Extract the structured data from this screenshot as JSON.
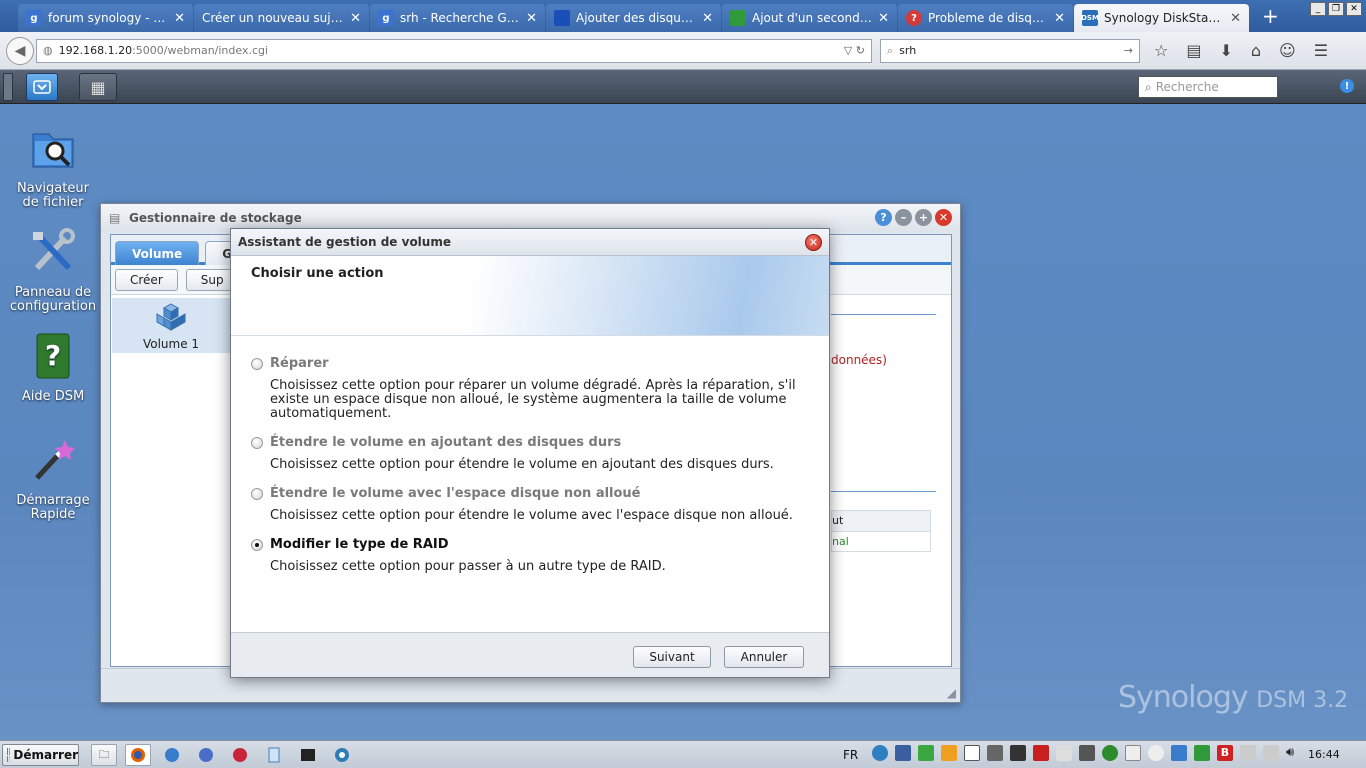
{
  "browser": {
    "tabs": [
      {
        "title": "forum synology - Rech...",
        "favicon_color": "#3b74d0",
        "favicon": "g"
      },
      {
        "title": "Créer un nouveau sujet - ...",
        "favicon_color": "",
        "favicon": ""
      },
      {
        "title": "srh - Recherche Google",
        "favicon_color": "#3b74d0",
        "favicon": "g"
      },
      {
        "title": "Ajouter des disques d...",
        "favicon_color": "#1a4fb8",
        "favicon": ""
      },
      {
        "title": "Ajout d'un second disq...",
        "favicon_color": "#2e9a3a",
        "favicon": ""
      },
      {
        "title": "Probleme de disque su...",
        "favicon_color": "#d43a3a",
        "favicon": "?"
      },
      {
        "title": "Synology DiskStation -...",
        "favicon_color": "#2a6fb8",
        "favicon": "DSM"
      }
    ],
    "url_host": "192.168.1.20",
    "url_path": ":5000/webman/index.cgi",
    "search_value": "srh"
  },
  "dsm": {
    "search_placeholder": "Recherche",
    "desktop_icons": [
      {
        "label_line1": "Navigateur",
        "label_line2": "de fichier",
        "icon": "file-browser-icon"
      },
      {
        "label_line1": "Panneau de",
        "label_line2": "configuration",
        "icon": "control-panel-icon"
      },
      {
        "label_line1": "Aide DSM",
        "label_line2": "",
        "icon": "help-icon"
      },
      {
        "label_line1": "Démarrage",
        "label_line2": "Rapide",
        "icon": "quick-start-icon"
      }
    ],
    "watermark_brand": "Synology",
    "watermark_version": "DSM 3.2"
  },
  "storage_manager": {
    "title": "Gestionnaire de stockage",
    "tabs": [
      "Volume",
      "G"
    ],
    "toolbar": [
      "Créer",
      "Sup"
    ],
    "volume_item": "Volume 1",
    "right_text_1": "données)",
    "right_text_2": "ut",
    "right_text_3": "nal"
  },
  "wizard": {
    "title": "Assistant de gestion de volume",
    "header": "Choisir une action",
    "options": [
      {
        "label": "Réparer",
        "desc": "Choisissez cette option pour réparer un volume dégradé. Après la réparation, s'il existe un espace disque non alloué, le système augmentera la taille de volume automatiquement.",
        "enabled": false,
        "checked": false
      },
      {
        "label": "Étendre le volume en ajoutant des disques durs",
        "desc": "Choisissez cette option pour étendre le volume en ajoutant des disques durs.",
        "enabled": false,
        "checked": false
      },
      {
        "label": "Étendre le volume avec l'espace disque non alloué",
        "desc": "Choisissez cette option pour étendre le volume avec l'espace disque non alloué.",
        "enabled": false,
        "checked": false
      },
      {
        "label": "Modifier le type de RAID",
        "desc": "Choisissez cette option pour passer à un autre type de RAID.",
        "enabled": true,
        "checked": true
      }
    ],
    "next_label": "Suivant",
    "cancel_label": "Annuler"
  },
  "taskbar": {
    "start_label": "Démarrer",
    "language": "FR",
    "clock": "16:44"
  }
}
